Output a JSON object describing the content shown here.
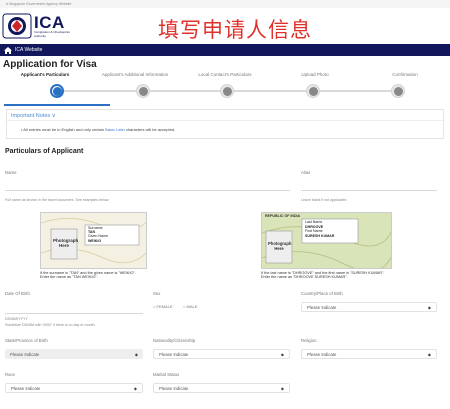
{
  "top_strip": {
    "text": "A Singapore Government Agency Website"
  },
  "header": {
    "logo": "ICA",
    "logo_subtitle": "Immigration & Checkpoints Authority",
    "overlay_title": "填写申请人信息"
  },
  "nav": {
    "home_icon": "home-icon",
    "label": "ICA Website"
  },
  "page_title": "Application for Visa",
  "steps": [
    {
      "label": "Applicant's Particulars",
      "active": true,
      "icon": "edit-icon"
    },
    {
      "label": "Applicant's Additional Information",
      "active": false,
      "icon": "edit-icon"
    },
    {
      "label": "Local Contact's Particulars",
      "active": false,
      "icon": "edit-icon"
    },
    {
      "label": "Upload Photo",
      "active": false,
      "icon": "photo-icon"
    },
    {
      "label": "Confirmation",
      "active": false,
      "icon": "check-icon"
    }
  ],
  "important_notes": {
    "title": "Important Notes",
    "text_before": "All entries must be in English and only certain ",
    "link": "Basic Latin",
    "text_after": " characters will be accepted."
  },
  "section_title": "Particulars of Applicant",
  "form": {
    "name_label": "Name",
    "name_hint": "Full name as shown in the travel document. See examples below.",
    "alias_label": "Alias",
    "alias_hint": "Leave blank if not applicable.",
    "passport1": {
      "lines": [
        "Surname",
        "TAN",
        "Given Name",
        "WEIKIO"
      ],
      "photo_text": "Photograph Here",
      "caption_1": "If the surname is \"TAN\" and the given name is \"WEIKIO\".",
      "caption_2": "Enter the name as \"TAN WEIKIO\"."
    },
    "passport2": {
      "header": "REPUBLIC OF INDIA",
      "lines": [
        "Last Name",
        "DHROOVE",
        "First Name",
        "SURESH KUMAR"
      ],
      "photo_text": "Photograph Here",
      "caption_1": "If the last name is \"DHROOVE\" and the first name is \"SURESH KUMAR\".",
      "caption_2": "Enter the name as \"DHROOVE SURESH KUMAR\"."
    },
    "dob_label": "Date Of Birth",
    "dob_placeholder": "DD/MM/YYYY",
    "dob_hint": "Substitute DD/MM with '0000' if there is no day or month.",
    "sex_label": "Sex",
    "sex_female": "FEMALE",
    "sex_male": "MALE",
    "country_label": "Country/Place of Birth",
    "country_value": "Please Indicate",
    "state_label": "State/Province of Birth",
    "state_value": "Please Indicate",
    "nationality_label": "Nationality/Citizenship",
    "nationality_value": "Please Indicate",
    "religion_label": "Religion",
    "religion_value": "Please Indicate",
    "race_label": "Race",
    "race_value": "Please Indicate",
    "marital_label": "Marital Status",
    "marital_value": "Please Indicate"
  }
}
